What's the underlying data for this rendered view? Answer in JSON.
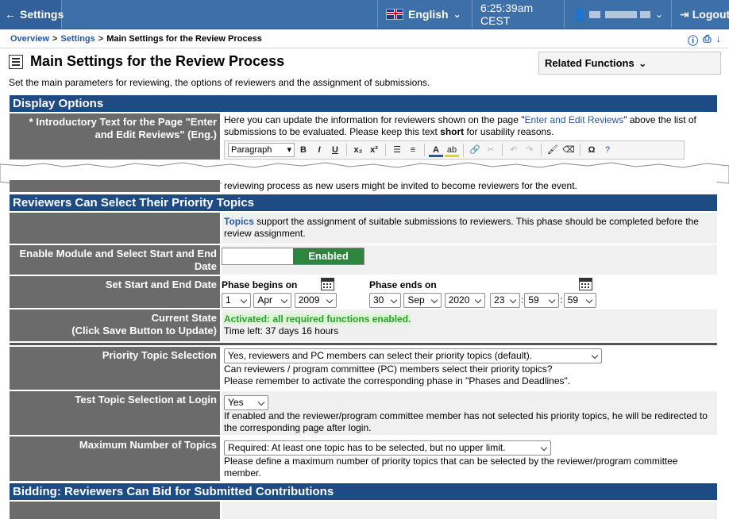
{
  "topbar": {
    "back_label": "Settings",
    "language": "English",
    "time": "6:25:39am CEST",
    "logout": "Logout"
  },
  "breadcrumb": {
    "overview": "Overview",
    "settings": "Settings",
    "current": "Main Settings for the Review Process"
  },
  "page": {
    "title": "Main Settings for the Review Process",
    "related": "Related Functions",
    "subtitle": "Set the main parameters for reviewing, the options of reviewers and the assignment of submissions."
  },
  "display_options": {
    "heading": "Display Options",
    "intro_label": "* Introductory Text for the Page \"Enter and Edit Reviews\" (Eng.)",
    "intro_text_a": "Here you can update the information for reviewers shown on the page \"",
    "intro_link": "Enter and Edit Reviews",
    "intro_text_b": "\" above the list of submissions to be evaluated. Please keep this text ",
    "intro_bold": "short",
    "intro_text_c": " for usability reasons.",
    "editor_format": "Paragraph",
    "cut_text": "reviewing process as new users might be invited to become reviewers for the event."
  },
  "topics": {
    "heading": "Reviewers Can Select Their Priority Topics",
    "info_link": "Topics",
    "info_text": " support the assignment of suitable submissions to reviewers. This phase should be completed before the review assignment.",
    "enable_label": "Enable Module and Select Start and End Date",
    "enable_state": "Enabled",
    "dates_label": "Set Start and End Date",
    "phase_begins": "Phase begins on",
    "phase_ends": "Phase ends on",
    "begin_day": "1",
    "begin_month": "Apr",
    "begin_year": "2009",
    "end_day": "30",
    "end_month": "Sep",
    "end_year": "2020",
    "end_hour": "23",
    "end_min": "59",
    "end_sec": "59",
    "state_label_1": "Current State",
    "state_label_2": "(Click Save Button to Update)",
    "state_status": "Activated: all required functions enabled.",
    "state_timeleft": "Time left: 37 days 16 hours",
    "priority_label": "Priority Topic Selection",
    "priority_value": "Yes, reviewers and PC members can select their priority topics (default).",
    "priority_help_1": "Can reviewers / program committee (PC) members select their priority topics?",
    "priority_help_2": "Please remember to activate the corresponding phase in \"Phases and Deadlines\".",
    "test_label": "Test Topic Selection at Login",
    "test_value": "Yes",
    "test_help": "If enabled and the reviewer/program committee member has not selected his priority topics, he will be redirected to the corresponding page after login.",
    "max_label": "Maximum Number of Topics",
    "max_value": "Required: At least one topic has to be selected, but no upper limit.",
    "max_help": "Please define a maximum number of priority topics that can be selected by the reviewer/program committee member."
  },
  "bidding": {
    "heading": "Bidding: Reviewers Can Bid for Submitted Contributions"
  },
  "colors": {
    "topbar": "#3d6fa8",
    "section": "#1f4b84",
    "label_bg": "#6b6b6b",
    "enabled": "#2e8540"
  }
}
